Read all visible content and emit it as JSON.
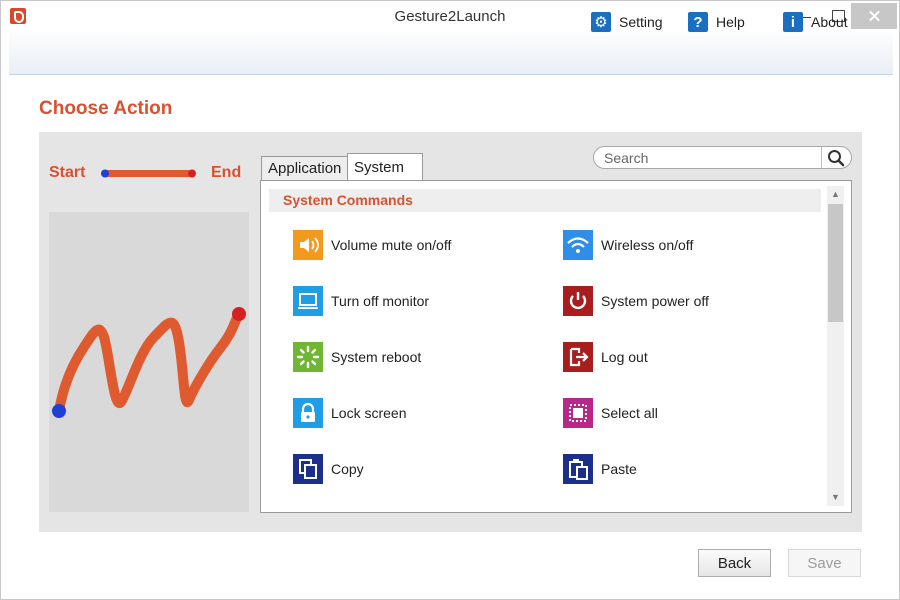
{
  "window": {
    "title": "Gesture2Launch"
  },
  "toolbar": {
    "setting_label": "Setting",
    "help_label": "Help",
    "about_label": "About"
  },
  "page": {
    "title": "Choose Action"
  },
  "gesture": {
    "start_label": "Start",
    "end_label": "End"
  },
  "tabs": [
    {
      "label": "Application",
      "active": false
    },
    {
      "label": "System",
      "active": true
    }
  ],
  "search": {
    "placeholder": "Search"
  },
  "section": {
    "title": "System Commands"
  },
  "commands": [
    {
      "label": "Volume mute on/off",
      "icon": "speaker-icon",
      "color": "#f39a1e"
    },
    {
      "label": "Wireless on/off",
      "icon": "wifi-icon",
      "color": "#2e8ee8"
    },
    {
      "label": "Turn off monitor",
      "icon": "monitor-icon",
      "color": "#1f9ee6"
    },
    {
      "label": "System power off",
      "icon": "power-icon",
      "color": "#a81d1d"
    },
    {
      "label": "System reboot",
      "icon": "reboot-icon",
      "color": "#6fb633"
    },
    {
      "label": "Log out",
      "icon": "logout-icon",
      "color": "#a81d1d"
    },
    {
      "label": "Lock screen",
      "icon": "lock-icon",
      "color": "#1f9ee6"
    },
    {
      "label": "Select all",
      "icon": "select-all-icon",
      "color": "#b8278a"
    },
    {
      "label": "Copy",
      "icon": "copy-icon",
      "color": "#1c2f8a"
    },
    {
      "label": "Paste",
      "icon": "paste-icon",
      "color": "#1c2f8a"
    }
  ],
  "buttons": {
    "back_label": "Back",
    "save_label": "Save"
  },
  "colors": {
    "accent": "#d65231",
    "start_dot": "#1f3fd6",
    "end_dot": "#d42020"
  }
}
